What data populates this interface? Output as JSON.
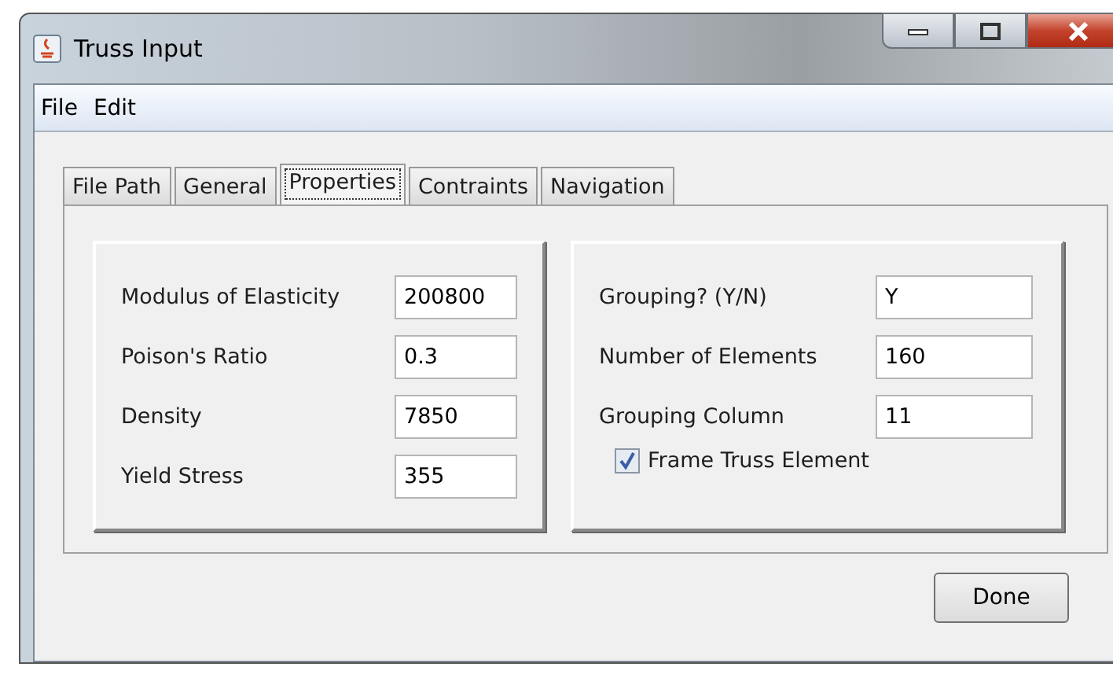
{
  "window": {
    "title": "Truss Input"
  },
  "menu": [
    "File",
    "Edit"
  ],
  "tabs": [
    {
      "label": "File Path",
      "selected": false
    },
    {
      "label": "General",
      "selected": false
    },
    {
      "label": "Properties",
      "selected": true
    },
    {
      "label": "Contraints",
      "selected": false
    },
    {
      "label": "Navigation",
      "selected": false
    }
  ],
  "left_group": [
    {
      "label": "Modulus of Elasticity",
      "value": "200800"
    },
    {
      "label": "Poison's Ratio",
      "value": "0.3"
    },
    {
      "label": "Density",
      "value": "7850"
    },
    {
      "label": "Yield Stress",
      "value": "355"
    }
  ],
  "right_group": {
    "fields": [
      {
        "label": "Grouping? (Y/N)",
        "value": "Y"
      },
      {
        "label": "Number of Elements",
        "value": "160"
      },
      {
        "label": "Grouping Column",
        "value": "11"
      }
    ],
    "checkbox": {
      "label": "Frame Truss Element",
      "checked": true
    }
  },
  "buttons": [
    "Done"
  ]
}
